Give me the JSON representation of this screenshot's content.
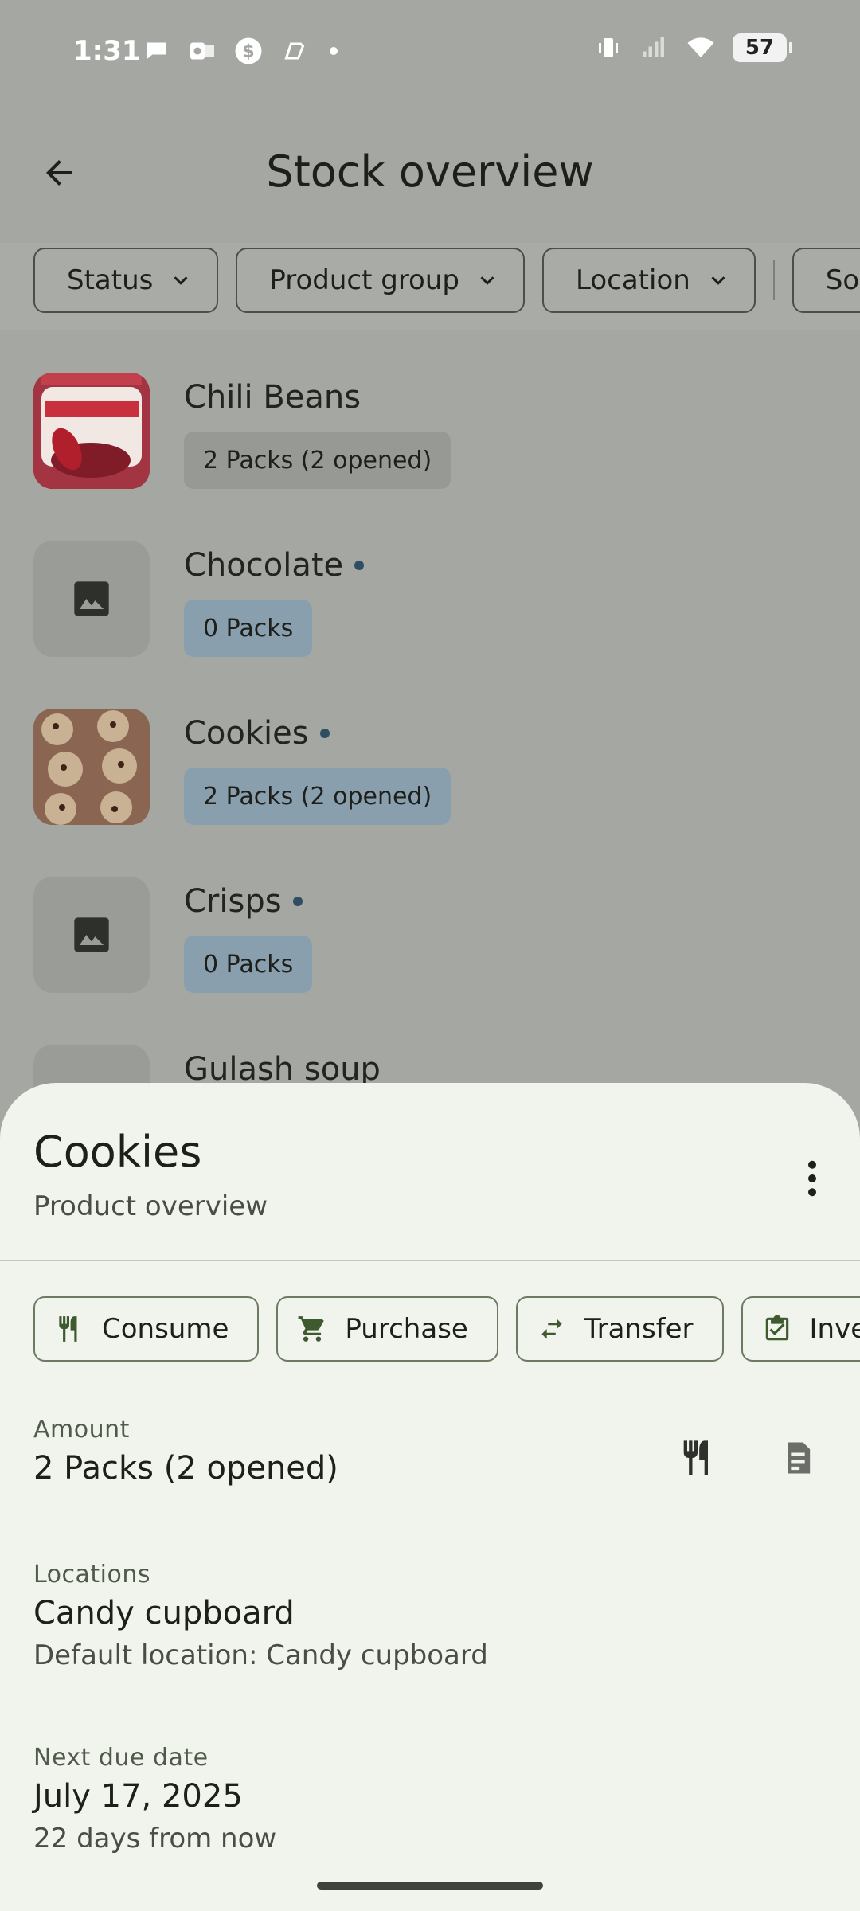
{
  "status_bar": {
    "time": "1:31",
    "battery": "57",
    "left_icons": [
      "chat-bubble-icon",
      "outlook-icon",
      "dollar-icon",
      "copilot-icon"
    ],
    "right_icons": [
      "vibrate-icon",
      "signal-icon",
      "wifi-icon",
      "battery-icon"
    ]
  },
  "appbar": {
    "title": "Stock overview"
  },
  "filters": [
    {
      "label": "Status"
    },
    {
      "label": "Product group"
    },
    {
      "label": "Location"
    },
    {
      "label": "Sort"
    }
  ],
  "products": [
    {
      "name": "Chili Beans",
      "amount": "2 Packs (2 opened)",
      "has_dot": false,
      "badge_style": "neutral",
      "image": "chili-beans-can"
    },
    {
      "name": "Chocolate",
      "amount": "0 Packs",
      "has_dot": true,
      "badge_style": "blue",
      "image": "placeholder"
    },
    {
      "name": "Cookies",
      "amount": "2 Packs (2 opened)",
      "has_dot": true,
      "badge_style": "blue",
      "image": "cookies-photo"
    },
    {
      "name": "Crisps",
      "amount": "0 Packs",
      "has_dot": true,
      "badge_style": "blue",
      "image": "placeholder"
    },
    {
      "name": "Gulash soup",
      "amount": "",
      "has_dot": false,
      "badge_style": "neutral",
      "image": "placeholder"
    }
  ],
  "sheet": {
    "title": "Cookies",
    "subtitle": "Product overview",
    "actions": [
      {
        "label": "Consume",
        "icon": "fork-knife-icon"
      },
      {
        "label": "Purchase",
        "icon": "cart-icon"
      },
      {
        "label": "Transfer",
        "icon": "transfer-icon"
      },
      {
        "label": "Inventory",
        "icon": "clipboard-check-icon"
      }
    ],
    "amount": {
      "label": "Amount",
      "value": "2 Packs (2 opened)"
    },
    "locations": {
      "label": "Locations",
      "value": "Candy cupboard",
      "sub": "Default location: Candy cupboard"
    },
    "due": {
      "label": "Next due date",
      "value": "July 17, 2025",
      "sub": "22 days from now"
    }
  },
  "colors": {
    "scrim_bg": "#a5a8a2",
    "sheet_bg": "#f1f4ec",
    "blue_badge": "#8a9fae",
    "dot": "#2f4e63",
    "outline_green": "#6c7a63",
    "icon_green": "#3e5a2e"
  }
}
